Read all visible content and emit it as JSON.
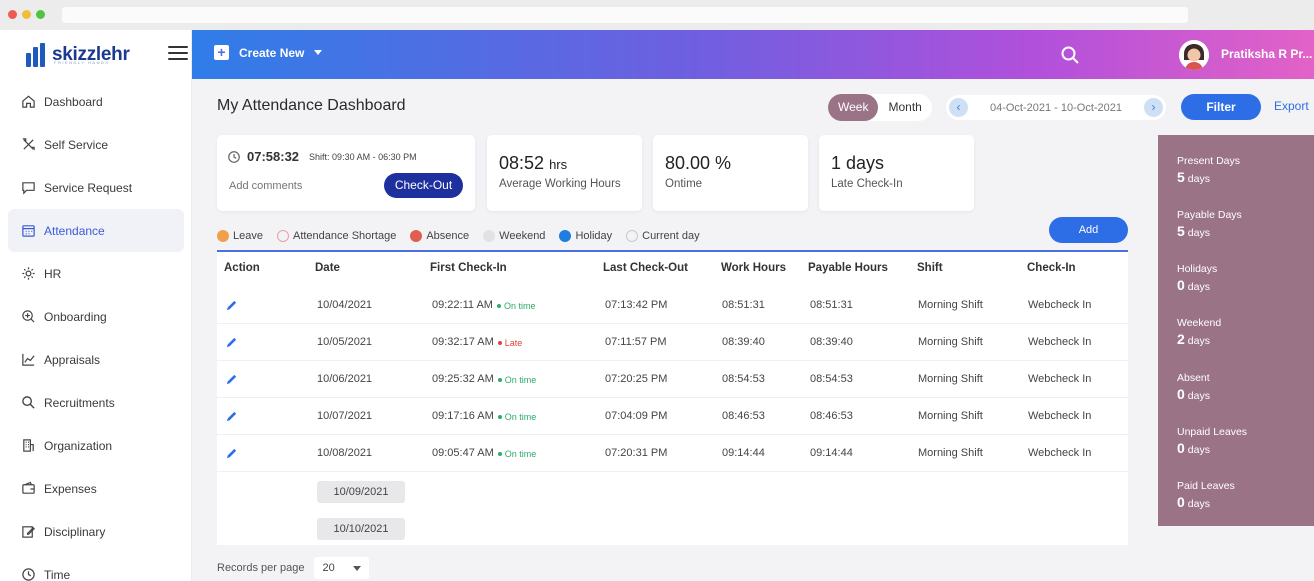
{
  "brand": {
    "name": "skizzlehr",
    "tagline": "FRIENDLY HANDS"
  },
  "sidebar": {
    "items": [
      {
        "label": "Dashboard",
        "icon": "home-icon"
      },
      {
        "label": "Self Service",
        "icon": "tools-icon"
      },
      {
        "label": "Service Request",
        "icon": "chat-icon"
      },
      {
        "label": "Attendance",
        "icon": "calendar-icon",
        "active": true
      },
      {
        "label": "HR",
        "icon": "gear-icon"
      },
      {
        "label": "Onboarding",
        "icon": "zoom-plus-icon"
      },
      {
        "label": "Appraisals",
        "icon": "chart-line-icon"
      },
      {
        "label": "Recruitments",
        "icon": "search-icon"
      },
      {
        "label": "Organization",
        "icon": "building-icon"
      },
      {
        "label": "Expenses",
        "icon": "wallet-icon"
      },
      {
        "label": "Disciplinary",
        "icon": "edit-icon"
      },
      {
        "label": "Time",
        "icon": "clock-icon"
      }
    ]
  },
  "header": {
    "create_label": "Create New",
    "user_name": "Pratiksha R Pr..."
  },
  "page": {
    "title": "My Attendance Dashboard",
    "view_week": "Week",
    "view_month": "Month",
    "date_range": "04-Oct-2021 - 10-Oct-2021",
    "filter_label": "Filter",
    "export_label": "Export"
  },
  "checkin": {
    "time": "07:58:32",
    "shift": "Shift: 09:30 AM - 06:30 PM",
    "comment_placeholder": "Add comments",
    "checkout_label": "Check-Out"
  },
  "stats": [
    {
      "value": "08:52",
      "unit": "hrs",
      "label": "Average Working Hours"
    },
    {
      "value": "80.00 %",
      "unit": "",
      "label": "Ontime"
    },
    {
      "value": "1 days",
      "unit": "",
      "label": "Late Check-In"
    }
  ],
  "legend": [
    {
      "label": "Leave",
      "color": "#f0a04b",
      "outline": false
    },
    {
      "label": "Attendance Shortage",
      "color": "#e8a0a0",
      "outline": true
    },
    {
      "label": "Absence",
      "color": "#e06050",
      "outline": false
    },
    {
      "label": "Weekend",
      "color": "#e2e2e6",
      "outline": false
    },
    {
      "label": "Holiday",
      "color": "#1e7ee0",
      "outline": false
    },
    {
      "label": "Current day",
      "color": "#c8c8d0",
      "outline": true
    }
  ],
  "add_label": "Add",
  "table": {
    "columns": [
      "Action",
      "Date",
      "First Check-In",
      "Last Check-Out",
      "Work Hours",
      "Payable Hours",
      "Shift",
      "Check-In"
    ],
    "rows": [
      {
        "date": "10/04/2021",
        "first": "09:22:11 AM",
        "status": "On time",
        "late": false,
        "last": "07:13:42 PM",
        "work": "08:51:31",
        "payable": "08:51:31",
        "shift": "Morning Shift",
        "checkin": "Webcheck In"
      },
      {
        "date": "10/05/2021",
        "first": "09:32:17 AM",
        "status": "Late",
        "late": true,
        "last": "07:11:57 PM",
        "work": "08:39:40",
        "payable": "08:39:40",
        "shift": "Morning Shift",
        "checkin": "Webcheck In"
      },
      {
        "date": "10/06/2021",
        "first": "09:25:32 AM",
        "status": "On time",
        "late": false,
        "last": "07:20:25 PM",
        "work": "08:54:53",
        "payable": "08:54:53",
        "shift": "Morning Shift",
        "checkin": "Webcheck In"
      },
      {
        "date": "10/07/2021",
        "first": "09:17:16 AM",
        "status": "On time",
        "late": false,
        "last": "07:04:09 PM",
        "work": "08:46:53",
        "payable": "08:46:53",
        "shift": "Morning Shift",
        "checkin": "Webcheck In"
      },
      {
        "date": "10/08/2021",
        "first": "09:05:47 AM",
        "status": "On time",
        "late": false,
        "last": "07:20:31 PM",
        "work": "09:14:44",
        "payable": "09:14:44",
        "shift": "Morning Shift",
        "checkin": "Webcheck In"
      }
    ],
    "weekend_dates": [
      "10/09/2021",
      "10/10/2021"
    ]
  },
  "records": {
    "label": "Records per page",
    "value": "20"
  },
  "summary": [
    {
      "label": "Present Days",
      "value": "5",
      "unit": "days"
    },
    {
      "label": "Payable Days",
      "value": "5",
      "unit": "days"
    },
    {
      "label": "Holidays",
      "value": "0",
      "unit": "days"
    },
    {
      "label": "Weekend",
      "value": "2",
      "unit": "days"
    },
    {
      "label": "Absent",
      "value": "0",
      "unit": "days"
    },
    {
      "label": "Unpaid Leaves",
      "value": "0",
      "unit": "days"
    },
    {
      "label": "Paid Leaves",
      "value": "0",
      "unit": "days"
    }
  ],
  "colors": {
    "accent": "#2d6de6",
    "summary_bg": "#9a7387",
    "checkout": "#1e2f9e"
  }
}
